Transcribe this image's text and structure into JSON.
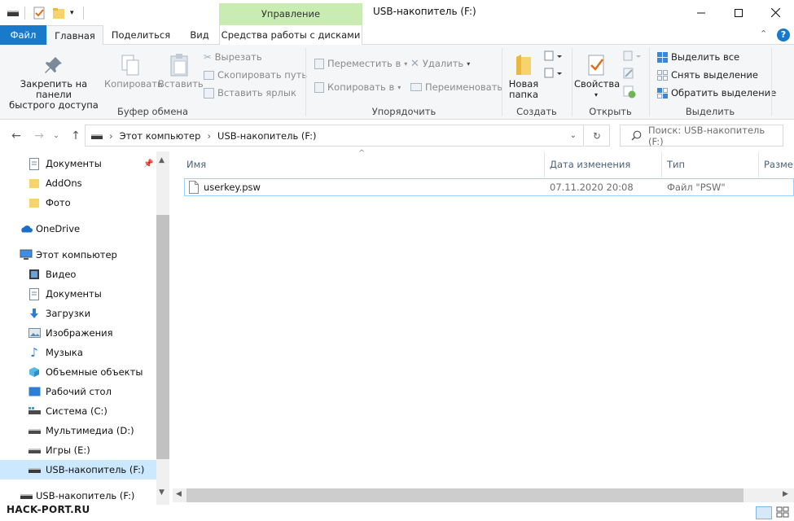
{
  "window": {
    "title": "USB-накопитель (F:)",
    "context_tab": "Управление"
  },
  "tabs": {
    "file": "Файл",
    "home": "Главная",
    "share": "Поделиться",
    "view": "Вид",
    "disk_tools": "Средства работы с дисками"
  },
  "ribbon": {
    "clipboard": {
      "pin": "Закрепить на панели быстрого доступа",
      "pin_line1": "Закрепить на панели",
      "pin_line2": "быстрого доступа",
      "copy": "Копировать",
      "paste": "Вставить",
      "cut": "Вырезать",
      "copy_path": "Скопировать путь",
      "paste_shortcut": "Вставить ярлык",
      "group": "Буфер обмена"
    },
    "organize": {
      "move_to": "Переместить в",
      "copy_to": "Копировать в",
      "delete": "Удалить",
      "rename": "Переименовать",
      "group": "Упорядочить"
    },
    "new": {
      "new_folder_line1": "Новая",
      "new_folder_line2": "папка",
      "group": "Создать"
    },
    "open": {
      "properties": "Свойства",
      "group": "Открыть"
    },
    "select": {
      "select_all": "Выделить все",
      "select_none": "Снять выделение",
      "invert": "Обратить выделение",
      "group": "Выделить"
    }
  },
  "address": {
    "crumbs": [
      "Этот компьютер",
      "USB-накопитель (F:)"
    ],
    "search_placeholder": "Поиск: USB-накопитель (F:)"
  },
  "nav": {
    "items": [
      {
        "label": "Документы",
        "icon": "documents-icon"
      },
      {
        "label": "AddOns",
        "icon": "folder-icon"
      },
      {
        "label": "Фото",
        "icon": "folder-icon"
      },
      {
        "label": "OneDrive",
        "icon": "onedrive-icon"
      },
      {
        "label": "Этот компьютер",
        "icon": "computer-icon"
      },
      {
        "label": "Видео",
        "icon": "video-icon"
      },
      {
        "label": "Документы",
        "icon": "documents-icon"
      },
      {
        "label": "Загрузки",
        "icon": "downloads-icon"
      },
      {
        "label": "Изображения",
        "icon": "pictures-icon"
      },
      {
        "label": "Музыка",
        "icon": "music-icon"
      },
      {
        "label": "Объемные объекты",
        "icon": "3d-objects-icon"
      },
      {
        "label": "Рабочий стол",
        "icon": "desktop-icon"
      },
      {
        "label": "Система (C:)",
        "icon": "system-drive-icon"
      },
      {
        "label": "Мультимедиа (D:)",
        "icon": "drive-icon"
      },
      {
        "label": "Игры (E:)",
        "icon": "drive-icon"
      },
      {
        "label": "USB-накопитель (F:)",
        "icon": "usb-drive-icon"
      },
      {
        "label": "USB-накопитель (F:)",
        "icon": "usb-drive-icon"
      }
    ]
  },
  "columns": {
    "name": "Имя",
    "date": "Дата изменения",
    "type": "Тип",
    "size": "Размер"
  },
  "files": [
    {
      "name": "userkey.psw",
      "date": "07.11.2020 20:08",
      "type": "Файл \"PSW\""
    }
  ],
  "watermark": "HACK-PORT.RU",
  "colors": {
    "accent": "#1979ca",
    "context_tab": "#c8ecb2",
    "selection": "#cce8ff"
  }
}
